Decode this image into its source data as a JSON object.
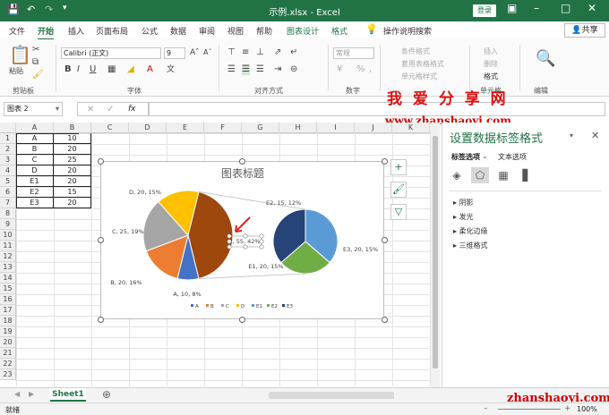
{
  "titlebar": {
    "title": "示例.xlsx  -  Excel",
    "login_label": "登录"
  },
  "tabs": [
    "文件",
    "开始",
    "插入",
    "页面布局",
    "公式",
    "数据",
    "审阅",
    "视图",
    "帮助",
    "图表设计",
    "格式"
  ],
  "tell_me": "操作说明搜索",
  "share_label": "共享",
  "ribbon": {
    "paste_label": "粘贴",
    "clipboard_label": "剪贴板",
    "font_label": "字体",
    "font_name": "Calibri (正文)",
    "font_size": "9",
    "bold": "B",
    "italic": "I",
    "underline": "U",
    "align_label": "对齐方式",
    "number_label": "数字",
    "number_format": "常规",
    "cond_format": "条件格式",
    "table_format": "套用表格格式",
    "cell_style": "单元格样式",
    "insert_label": "插入",
    "delete_label": "删除",
    "format_label": "格式",
    "cells_label": "单元格",
    "edit_label": "编辑"
  },
  "formula": {
    "name_box": "图表 2",
    "fx": "fx"
  },
  "watermark": {
    "line1": "我 爱 分 享 网",
    "line2": "www.zhanshaoyi.com",
    "bottom": "zhanshaoyi.com"
  },
  "columns": [
    "A",
    "B",
    "C",
    "D",
    "E",
    "F",
    "G",
    "H",
    "I",
    "J",
    "K"
  ],
  "rows": [
    "1",
    "2",
    "3",
    "4",
    "5",
    "6",
    "7",
    "8",
    "9",
    "10",
    "11",
    "12",
    "13",
    "14",
    "15",
    "16",
    "17",
    "18",
    "19",
    "20",
    "21",
    "22",
    "23"
  ],
  "table": [
    [
      "A",
      "10"
    ],
    [
      "B",
      "20"
    ],
    [
      "C",
      "25"
    ],
    [
      "D",
      "20"
    ],
    [
      "E1",
      "20"
    ],
    [
      "E2",
      "15"
    ],
    [
      "E3",
      "20"
    ]
  ],
  "chart_data": {
    "type": "pie",
    "title": "图表标题",
    "categories": [
      "A",
      "B",
      "C",
      "D",
      "E1",
      "E2",
      "E3"
    ],
    "values": [
      10,
      20,
      25,
      20,
      20,
      15,
      20
    ],
    "primary_labels": [
      "A, 10, 8%",
      "B, 20, 16%",
      "C, 25, 19%",
      "D, 20, 15%",
      "E, 55, 42%"
    ],
    "secondary_labels": [
      "E1, 20, 15%",
      "E2, 15, 12%",
      "E3, 20, 15%"
    ],
    "legend": [
      "A",
      "B",
      "C",
      "D",
      "E1",
      "E2",
      "E3"
    ],
    "colors": [
      "#4472c4",
      "#ed7d31",
      "#a5a5a5",
      "#ffc000",
      "#5b9bd5",
      "#70ad47",
      "#264478"
    ],
    "e_color": "#9e480e",
    "legend_position": "bottom"
  },
  "pane": {
    "title": "设置数据标签格式",
    "tab_label": "标签选项",
    "tab_text": "文本选项",
    "sections": [
      "阴影",
      "发光",
      "柔化边缘",
      "三维格式"
    ]
  },
  "sheet_tab": "Sheet1",
  "status": {
    "ready": "就绪",
    "zoom": "100%"
  }
}
